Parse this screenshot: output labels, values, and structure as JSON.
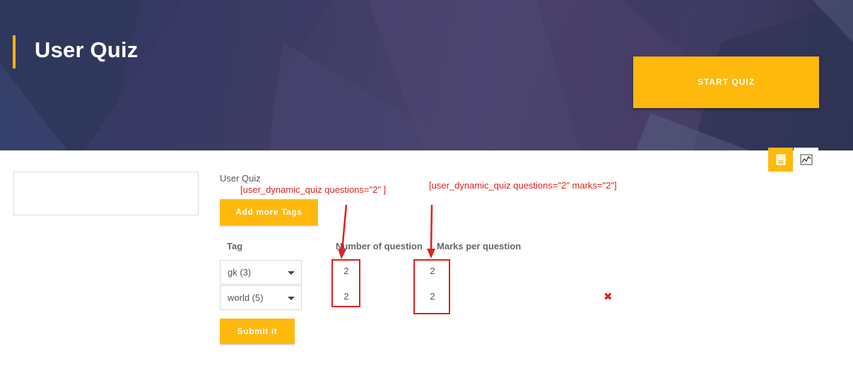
{
  "header": {
    "title": "User Quiz",
    "start_button": "START QUIZ"
  },
  "view_toggles": {
    "quiz_icon": "document-icon",
    "chart_icon": "chart-icon"
  },
  "form": {
    "section_label": "User Quiz",
    "add_button": "Add more Tags",
    "submit_button": "Submit it",
    "columns": {
      "tag": "Tag",
      "number": "Number of question",
      "marks": "Marks per question"
    },
    "rows": [
      {
        "tag": "gk (3)",
        "number": "2",
        "marks": "2"
      },
      {
        "tag": "world (5)",
        "number": "2",
        "marks": "2"
      }
    ],
    "remove_icon": "✖"
  },
  "annotations": {
    "shortcode_1": "[user_dynamic_quiz questions=\"2\" ]",
    "shortcode_2": "[user_dynamic_quiz questions=\"2\" marks=\"2\"]"
  },
  "colors": {
    "accent": "#ffb80c",
    "annotation": "#e02020",
    "hero": "#3f3c66"
  }
}
